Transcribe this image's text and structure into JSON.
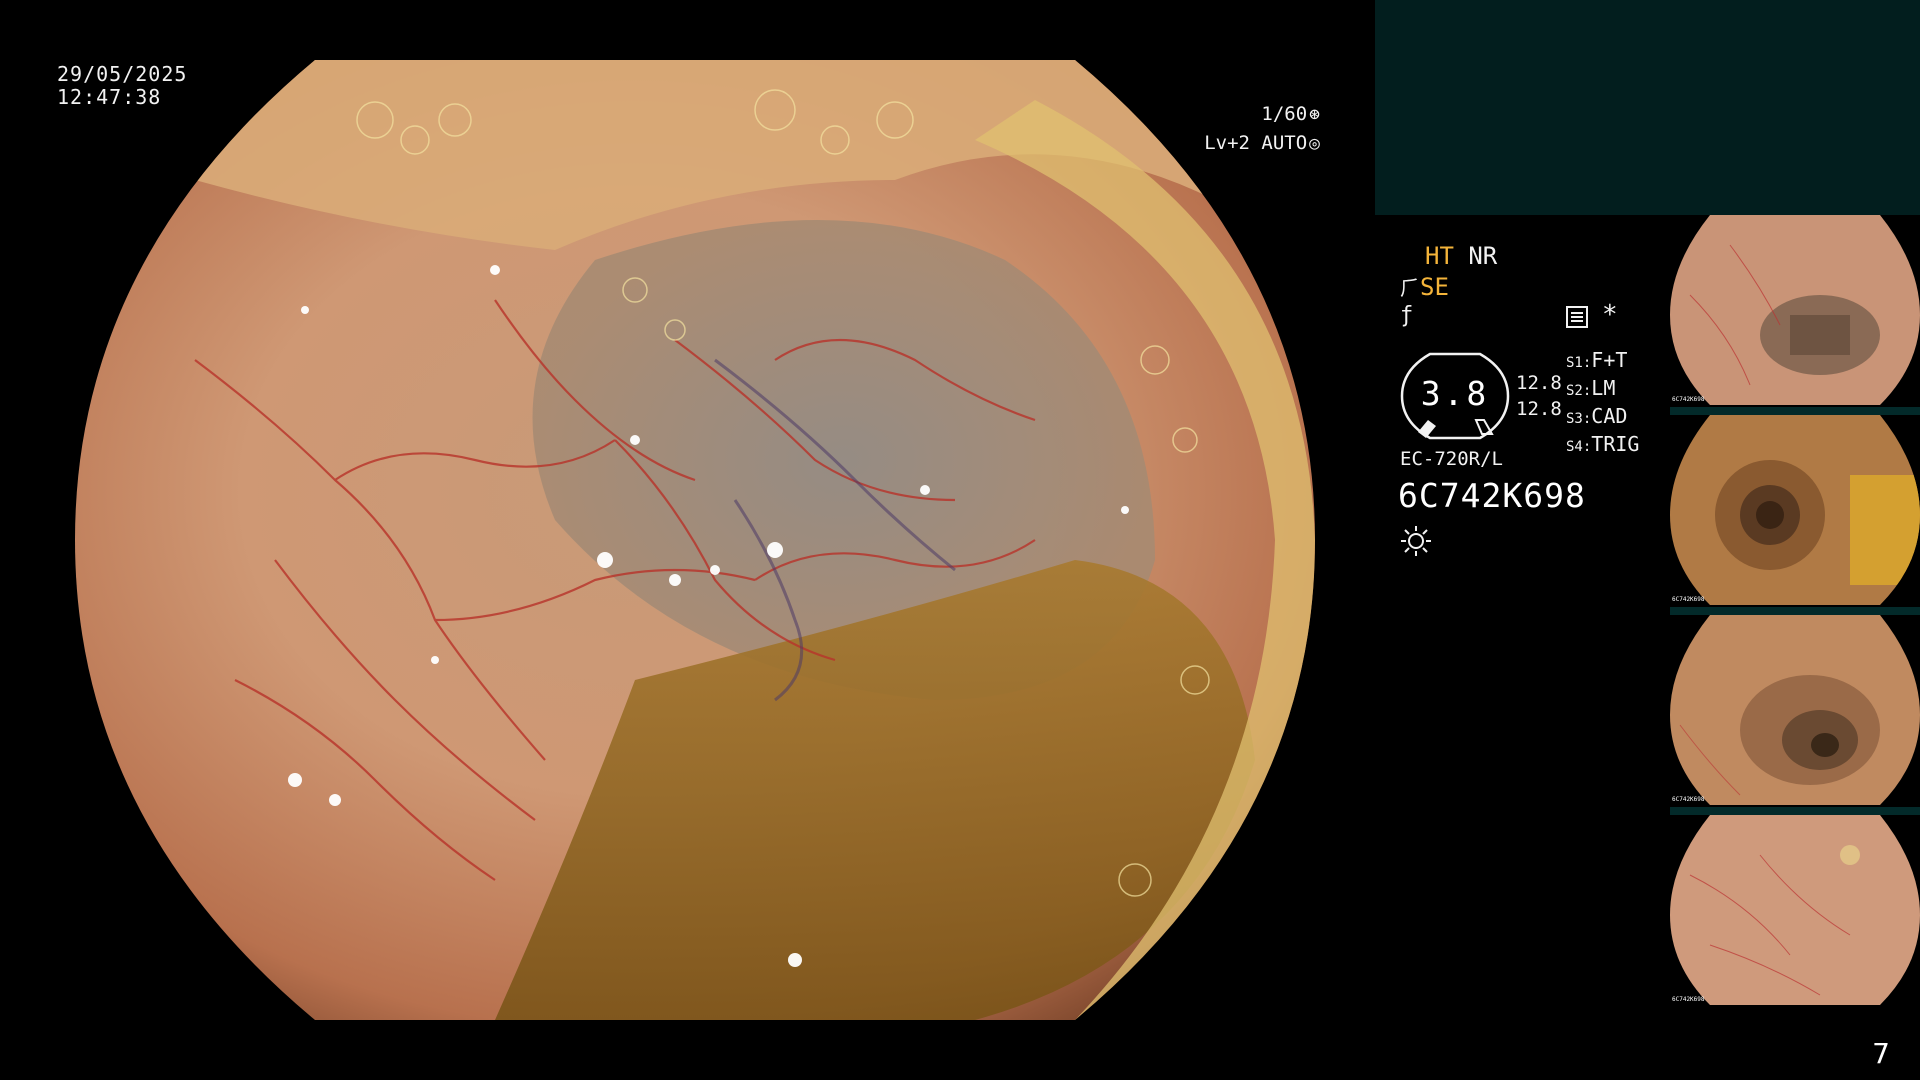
{
  "overlay": {
    "date": "29/05/2025",
    "time": "12:47:38",
    "shutter": "1/60",
    "shutter_icon": "aperture-icon",
    "iris": "Lv+2 AUTO",
    "iris_icon": "target-icon"
  },
  "settings": {
    "mode_ht": "HT",
    "mode_nr": "NR",
    "mode_se": "SE",
    "gauge_value": "3.8",
    "gauge_side_1": "12.8",
    "gauge_side_2": "12.8",
    "switches": [
      {
        "key": "S1:",
        "value": "F+T"
      },
      {
        "key": "S2:",
        "value": "LM"
      },
      {
        "key": "S3:",
        "value": "CAD"
      },
      {
        "key": "S4:",
        "value": "TRIG"
      }
    ],
    "asterisk": "*",
    "scope_model": "EC-720R/L",
    "serial": "6C742K698"
  },
  "colors": {
    "accent_yellow": "#f4b43a",
    "panel_teal": "#021e1e"
  },
  "thumbnails": [
    {
      "caption": "6C742K698"
    },
    {
      "caption": "6C742K698"
    },
    {
      "caption": "6C742K698"
    },
    {
      "caption": "6C742K698"
    }
  ],
  "page_number": "7"
}
